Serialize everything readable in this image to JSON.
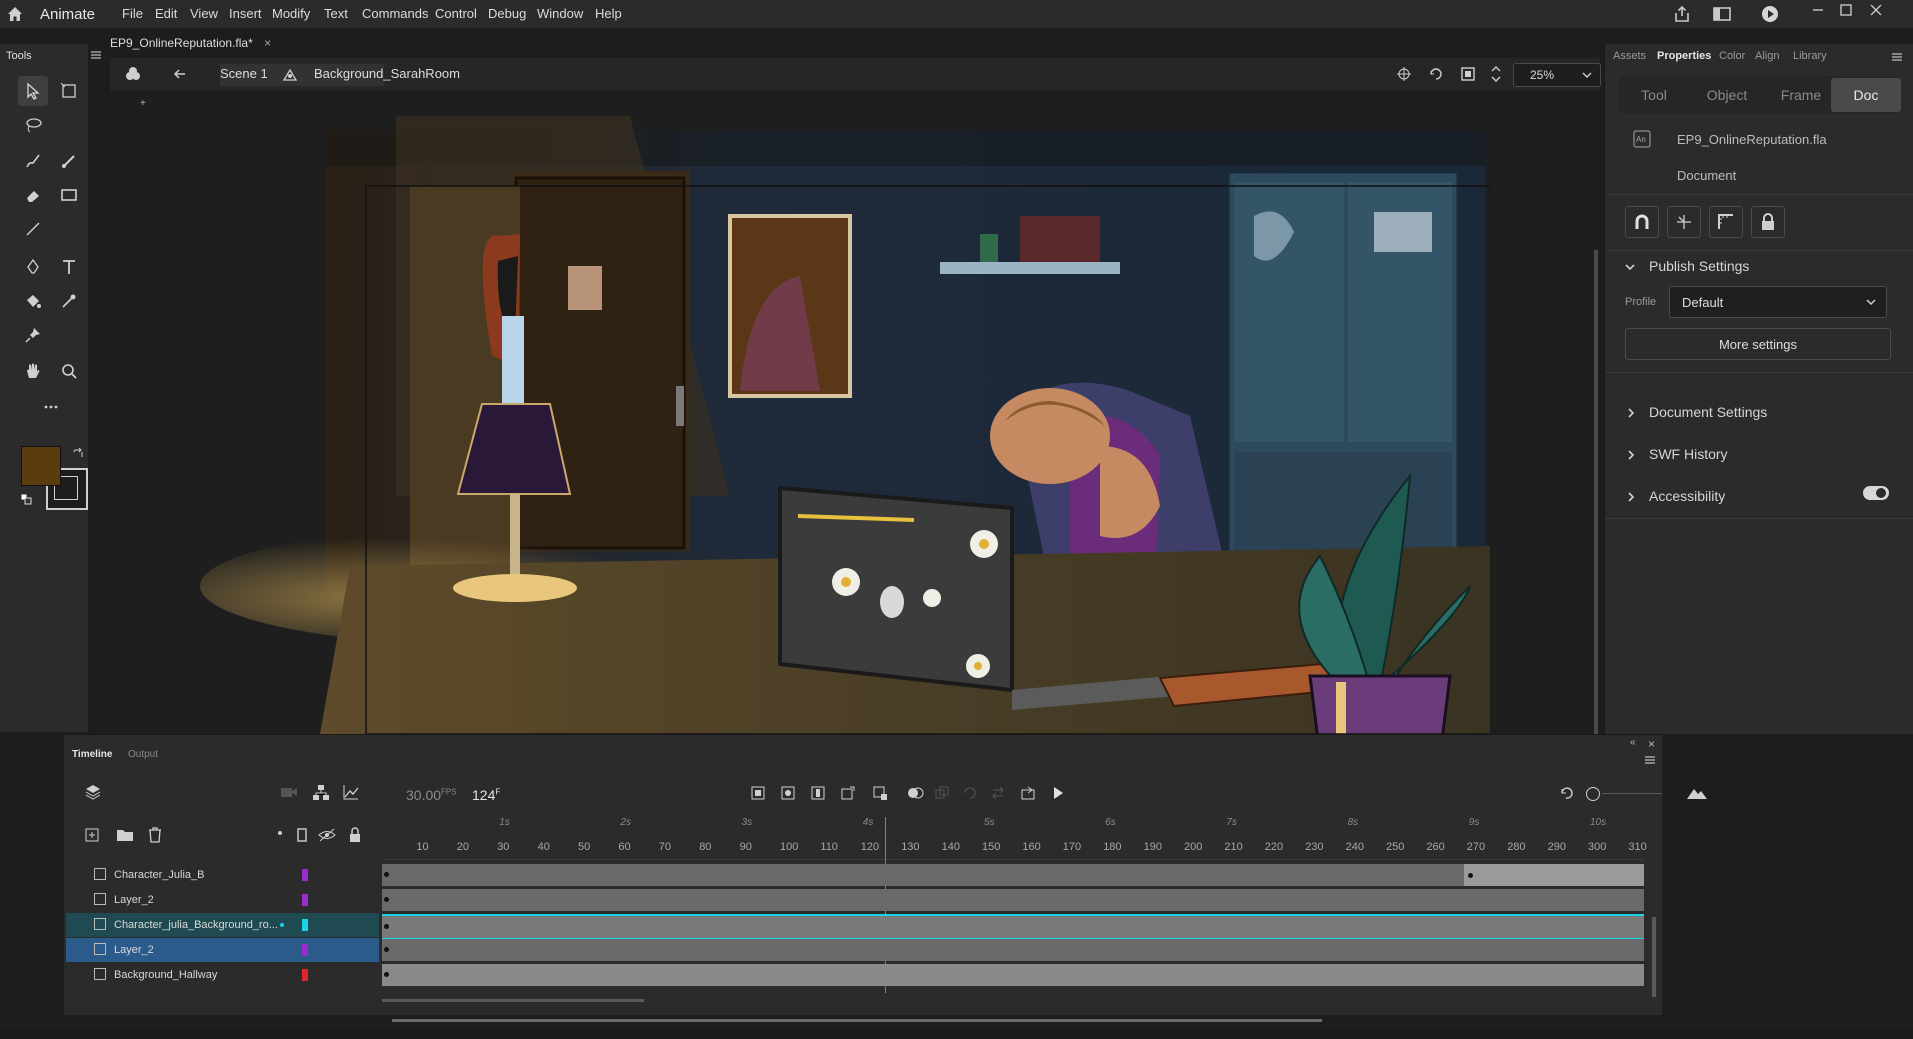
{
  "app": {
    "name": "Animate"
  },
  "menu": [
    "File",
    "Edit",
    "View",
    "Insert",
    "Modify",
    "Text",
    "Commands",
    "Control",
    "Debug",
    "Window",
    "Help"
  ],
  "tools_panel": {
    "title": "Tools",
    "fill_color": "#5a3d0e",
    "stroke_color": "#1d1d1d"
  },
  "document": {
    "tab_title": "EP9_OnlineReputation.fla*",
    "scene": "Scene 1",
    "symbol": "Background_SarahRoom",
    "zoom": "25%"
  },
  "right_panel": {
    "tabs": [
      "Assets",
      "Properties",
      "Color",
      "Align",
      "Library"
    ],
    "active_tab": "Properties",
    "segments": [
      "Tool",
      "Object",
      "Frame",
      "Doc"
    ],
    "active_segment": "Doc",
    "doc_name": "EP9_OnlineReputation.fla",
    "doc_type": "Document",
    "publish_settings": "Publish Settings",
    "profile_label": "Profile",
    "profile_value": "Default",
    "more_settings": "More settings",
    "document_settings": "Document Settings",
    "swf_history": "SWF History",
    "accessibility": "Accessibility"
  },
  "timeline": {
    "tabs": [
      "Timeline",
      "Output"
    ],
    "fps": "30.00",
    "fps_unit": "FPS",
    "frame": "124",
    "frame_unit": "F",
    "ruler_frames": [
      "10",
      "20",
      "30",
      "40",
      "50",
      "60",
      "70",
      "80",
      "90",
      "100",
      "110",
      "120",
      "130",
      "140",
      "150",
      "160",
      "170",
      "180",
      "190",
      "200",
      "210",
      "220",
      "230",
      "240",
      "250",
      "260",
      "270",
      "280",
      "290",
      "300",
      "310"
    ],
    "ruler_seconds": [
      "1s",
      "2s",
      "3s",
      "4s",
      "5s",
      "6s",
      "7s",
      "8s",
      "9s",
      "10s"
    ],
    "layers": [
      {
        "name": "Character_Julia_B",
        "color": "#9a2ccf"
      },
      {
        "name": "Layer_2",
        "color": "#9a2ccf"
      },
      {
        "name": "Character_julia_Background_ro...",
        "color": "#19d3e3"
      },
      {
        "name": "Layer_2",
        "color": "#9a2ccf"
      },
      {
        "name": "Background_Hallway",
        "color": "#e0262c"
      }
    ],
    "selected_layer": 3,
    "playhead_frame": 124
  }
}
